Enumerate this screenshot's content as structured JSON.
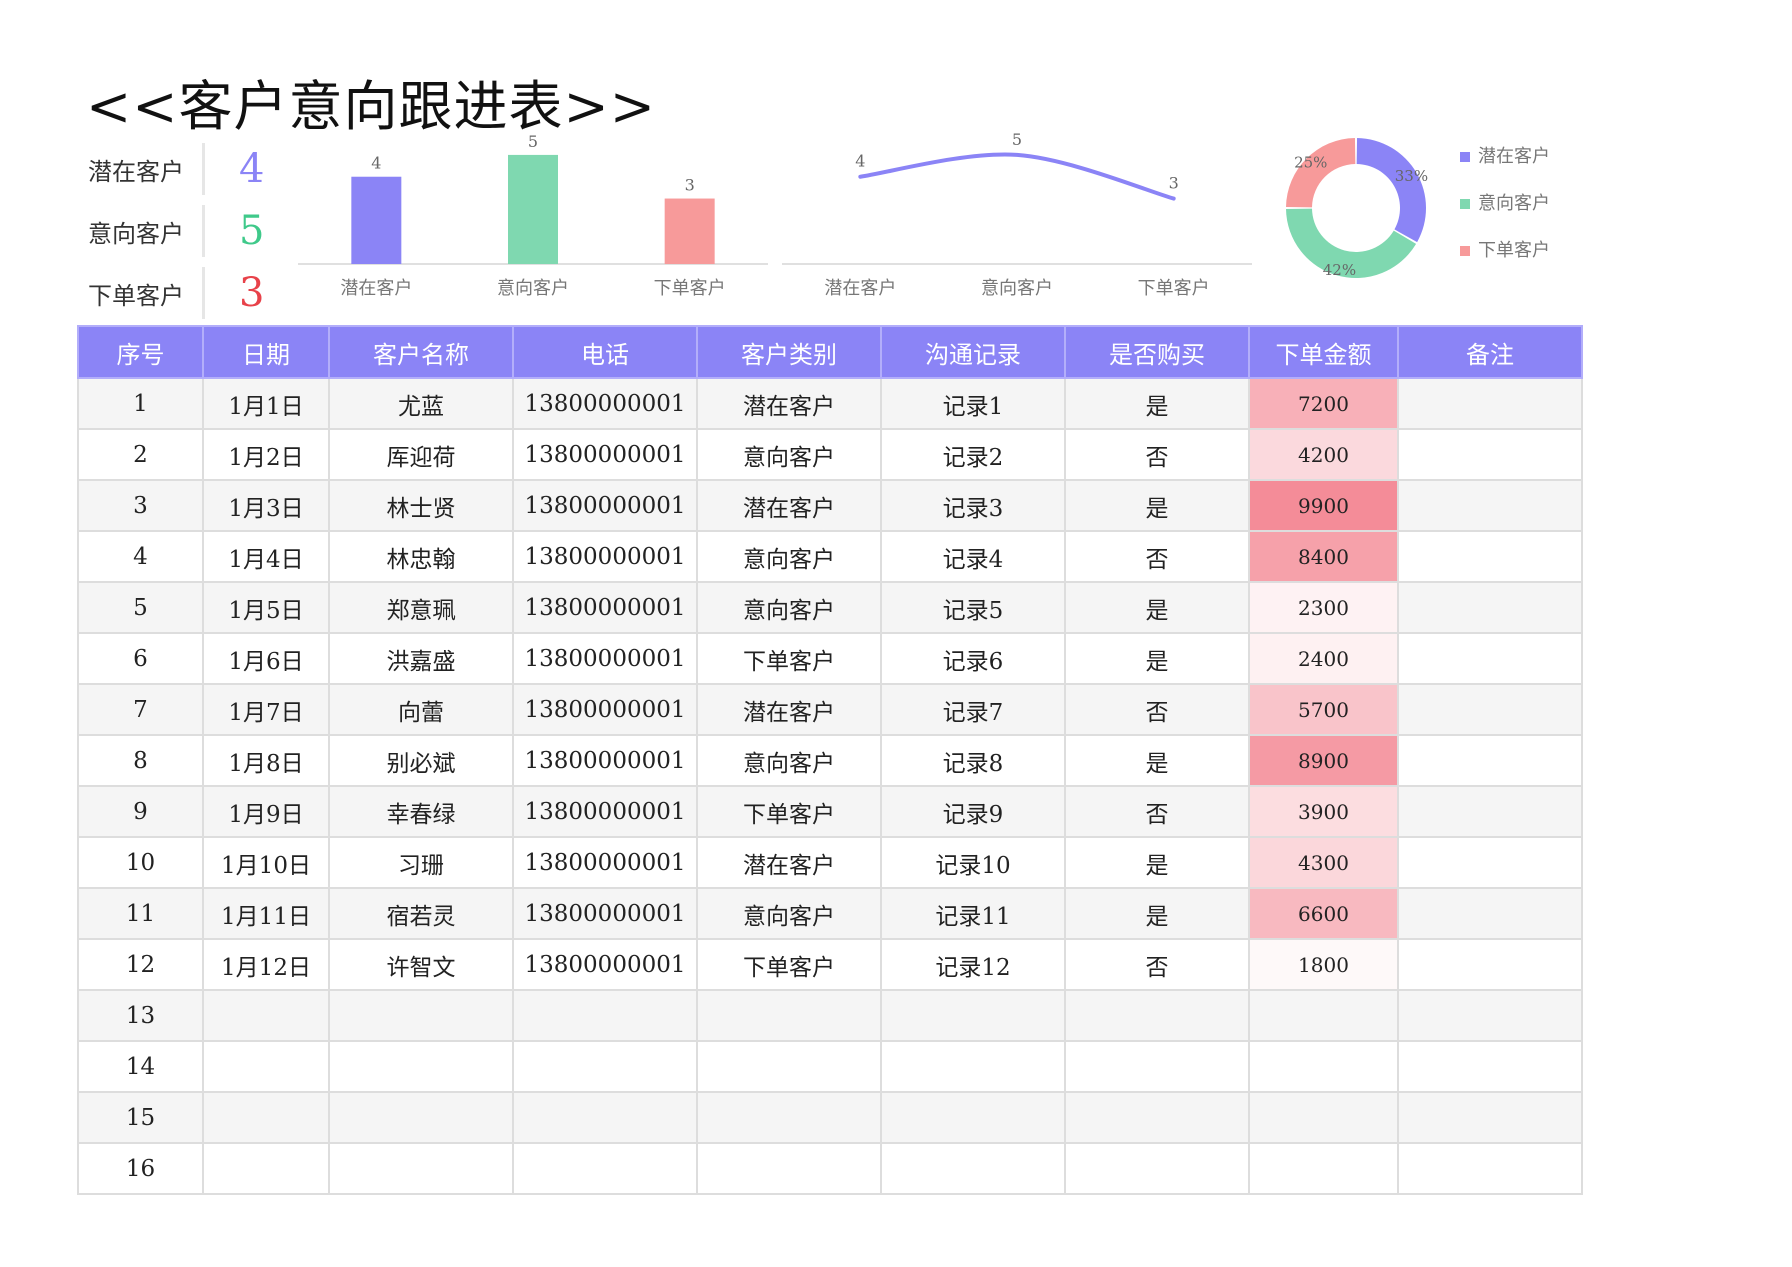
{
  "title": "<<客户意向跟进表>>",
  "summary": [
    {
      "label": "潜在客户",
      "value": "4",
      "color": "#8b84f6"
    },
    {
      "label": "意向客户",
      "value": "5",
      "color": "#3fc98a"
    },
    {
      "label": "下单客户",
      "value": "3",
      "color": "#e8424a"
    }
  ],
  "colors": {
    "purple": "#8b84f6",
    "green": "#7fd8b0",
    "pink": "#f79a9a",
    "header_bg": "#8b84f6",
    "amount_base": "#f06070"
  },
  "chart_data": [
    {
      "type": "bar",
      "categories": [
        "潜在客户",
        "意向客户",
        "下单客户"
      ],
      "values": [
        4,
        5,
        3
      ],
      "colors": [
        "#8b84f6",
        "#7fd8b0",
        "#f79a9a"
      ],
      "ylim": [
        0,
        5.5
      ]
    },
    {
      "type": "line",
      "categories": [
        "潜在客户",
        "意向客户",
        "下单客户"
      ],
      "values": [
        4,
        5,
        3
      ],
      "color": "#8b84f6",
      "ylim": [
        0,
        5.5
      ]
    },
    {
      "type": "pie",
      "labels": [
        "潜在客户",
        "意向客户",
        "下单客户"
      ],
      "values": [
        4,
        5,
        3
      ],
      "percent_labels": [
        "33%",
        "42%",
        "25%"
      ],
      "colors": [
        "#8b84f6",
        "#7fd8b0",
        "#f79a9a"
      ],
      "legend": "right"
    }
  ],
  "table": {
    "headers": [
      "序号",
      "日期",
      "客户名称",
      "电话",
      "客户类别",
      "沟通记录",
      "是否购买",
      "下单金额",
      "备注"
    ],
    "rows": [
      [
        "1",
        "1月1日",
        "尤蓝",
        "13800000001",
        "潜在客户",
        "记录1",
        "是",
        "7200",
        ""
      ],
      [
        "2",
        "1月2日",
        "厍迎荷",
        "13800000001",
        "意向客户",
        "记录2",
        "否",
        "4200",
        ""
      ],
      [
        "3",
        "1月3日",
        "林士贤",
        "13800000001",
        "潜在客户",
        "记录3",
        "是",
        "9900",
        ""
      ],
      [
        "4",
        "1月4日",
        "林忠翰",
        "13800000001",
        "意向客户",
        "记录4",
        "否",
        "8400",
        ""
      ],
      [
        "5",
        "1月5日",
        "郑意珮",
        "13800000001",
        "意向客户",
        "记录5",
        "是",
        "2300",
        ""
      ],
      [
        "6",
        "1月6日",
        "洪嘉盛",
        "13800000001",
        "下单客户",
        "记录6",
        "是",
        "2400",
        ""
      ],
      [
        "7",
        "1月7日",
        "向蕾",
        "13800000001",
        "潜在客户",
        "记录7",
        "否",
        "5700",
        ""
      ],
      [
        "8",
        "1月8日",
        "别必斌",
        "13800000001",
        "意向客户",
        "记录8",
        "是",
        "8900",
        ""
      ],
      [
        "9",
        "1月9日",
        "幸春绿",
        "13800000001",
        "下单客户",
        "记录9",
        "否",
        "3900",
        ""
      ],
      [
        "10",
        "1月10日",
        "习珊",
        "13800000001",
        "潜在客户",
        "记录10",
        "是",
        "4300",
        ""
      ],
      [
        "11",
        "1月11日",
        "宿若灵",
        "13800000001",
        "意向客户",
        "记录11",
        "是",
        "6600",
        ""
      ],
      [
        "12",
        "1月12日",
        "许智文",
        "13800000001",
        "下单客户",
        "记录12",
        "否",
        "1800",
        ""
      ],
      [
        "13",
        "",
        "",
        "",
        "",
        "",
        "",
        "",
        ""
      ],
      [
        "14",
        "",
        "",
        "",
        "",
        "",
        "",
        "",
        ""
      ],
      [
        "15",
        "",
        "",
        "",
        "",
        "",
        "",
        "",
        ""
      ],
      [
        "16",
        "",
        "",
        "",
        "",
        "",
        "",
        "",
        ""
      ]
    ]
  }
}
